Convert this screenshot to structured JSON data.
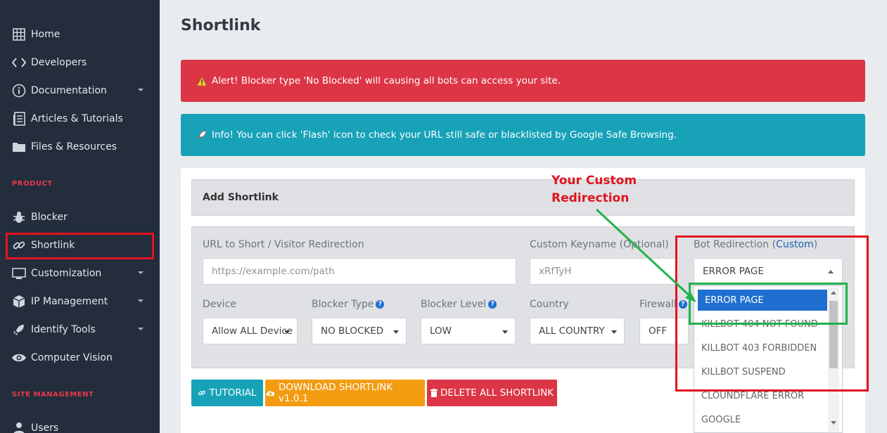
{
  "sidebar": {
    "items": [
      {
        "label": "Home",
        "icon": "grid-icon",
        "caret": false
      },
      {
        "label": "Developers",
        "icon": "code-icon",
        "caret": false
      },
      {
        "label": "Documentation",
        "icon": "info-icon",
        "caret": true
      },
      {
        "label": "Articles & Tutorials",
        "icon": "article-icon",
        "caret": false
      },
      {
        "label": "Files & Resources",
        "icon": "folder-icon",
        "caret": false
      }
    ],
    "section_product": "PRODUCT",
    "product_items": [
      {
        "label": "Blocker",
        "icon": "bug-icon",
        "caret": false
      },
      {
        "label": "Shortlink",
        "icon": "link-icon",
        "caret": false
      },
      {
        "label": "Customization",
        "icon": "monitor-icon",
        "caret": true
      },
      {
        "label": "IP Management",
        "icon": "cube-icon",
        "caret": true
      },
      {
        "label": "Identify Tools",
        "icon": "rocket-icon",
        "caret": true
      },
      {
        "label": "Computer Vision",
        "icon": "eye-icon",
        "caret": false
      }
    ],
    "section_site": "SITE MANAGEMENT",
    "site_items": [
      {
        "label": "Users",
        "icon": "user-icon"
      }
    ]
  },
  "page": {
    "title": "Shortlink"
  },
  "alerts": {
    "danger": "Alert! Blocker type 'No Blocked' will causing all bots can access your site.",
    "info": "Info! You can click 'Flash' icon to check your URL still safe or blacklisted by Google Safe Browsing."
  },
  "form": {
    "header": "Add Shortlink",
    "url_label": "URL to Short / Visitor Redirection",
    "url_placeholder": "https://example.com/path",
    "keyname_label": "Custom Keyname (Optional)",
    "keyname_value": "xRfTyH",
    "bot_redirection_label": "Bot Redirection (",
    "bot_redirection_link": "Custom",
    "bot_redirection_close": ")",
    "bot_redirection_value": "ERROR PAGE",
    "device_label": "Device",
    "device_value": "Allow ALL Device",
    "blocker_type_label": "Blocker Type",
    "blocker_type_value": "NO BLOCKED",
    "blocker_level_label": "Blocker Level",
    "blocker_level_value": "LOW",
    "country_label": "Country",
    "country_value": "ALL COUNTRY",
    "firewall_label": "Firewall",
    "firewall_value": "OFF",
    "help_glyph": "?"
  },
  "dropdown": {
    "options": [
      "ERROR PAGE",
      "KILLBOT 404 NOT FOUND",
      "KILLBOT 403 FORBIDDEN",
      "KILLBOT SUSPEND",
      "CLOUNDFLARE ERROR",
      "GOOGLE"
    ],
    "selected": "ERROR PAGE"
  },
  "buttons": {
    "tutorial": "TUTORIAL",
    "download": "DOWNLOAD SHORTLINK v1.0.1",
    "delete_all": "DELETE ALL SHORTLINK"
  },
  "annotation": {
    "line1": "Your Custom",
    "line2": "Redirection"
  },
  "colors": {
    "sidebar_bg": "#232d3c",
    "danger": "#dc3545",
    "info": "#17a2b8",
    "tutorial_btn": "#17a2b8",
    "download_btn": "#f39c12",
    "delete_btn": "#dc3545",
    "selected_option": "#1f6fd0",
    "annotation_red": "#e1141f",
    "annotation_green": "#21b24b"
  }
}
